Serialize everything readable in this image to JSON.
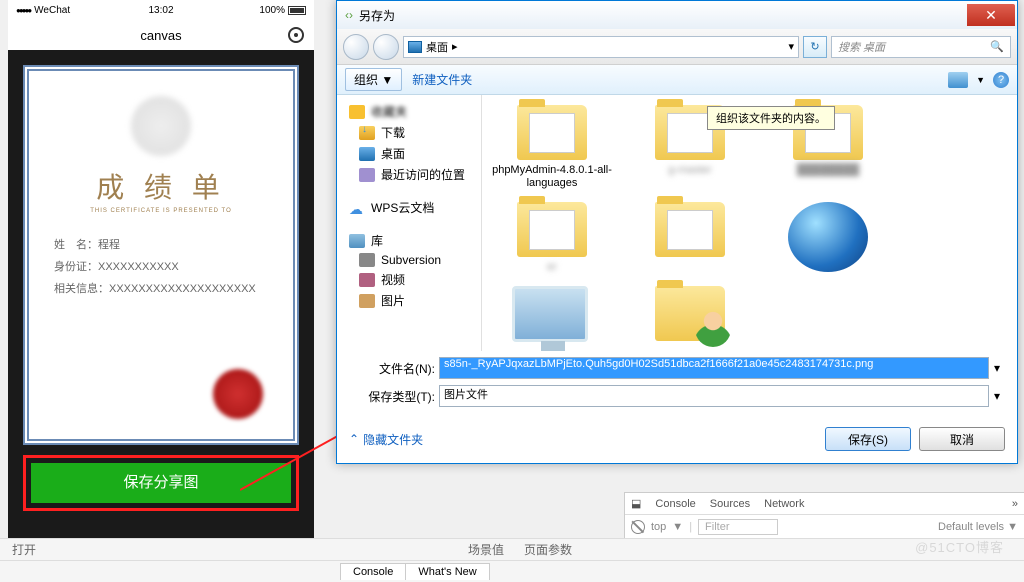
{
  "phone": {
    "carrier": "WeChat",
    "time": "13:02",
    "battery": "100%",
    "title": "canvas",
    "cert": {
      "title": "成 绩 单",
      "sub": "THIS CERTIFICATE IS PRESENTED TO",
      "name_label": "姓　名：",
      "name_value": "程程",
      "id_label": "身份证：",
      "id_value": "XXXXXXXXXXX",
      "info_label": "相关信息：",
      "info_value": "XXXXXXXXXXXXXXXXXXXX"
    },
    "share_button": "保存分享图"
  },
  "dialog": {
    "title": "另存为",
    "breadcrumb": "桌面",
    "breadcrumb_arrow": "▸",
    "search_placeholder": "搜索 桌面",
    "organize": "组织",
    "dropdown": "▼",
    "new_folder": "新建文件夹",
    "tooltip": "组织该文件夹的内容。",
    "tree": {
      "downloads": "下载",
      "desktop": "桌面",
      "recent": "最近访问的位置",
      "wps": "WPS云文档",
      "library": "库",
      "subversion": "Subversion",
      "video": "视频",
      "images": "图片"
    },
    "files": {
      "f1": "phpMyAdmin-4.8.0.1-all-languages",
      "f2": "g-master",
      "f3": "",
      "f4": "er"
    },
    "filename_label": "文件名(N):",
    "filename_value": "s85n-_RyAPJqxazLbMPjEto.Quh5gd0H02Sd51dbca2f1666f21a0e45c2483174731c.png",
    "filetype_label": "保存类型(T):",
    "filetype_value": "图片文件",
    "hide_folders": "隐藏文件夹",
    "save_btn": "保存(S)",
    "cancel_btn": "取消"
  },
  "bottombar": {
    "open": "打开",
    "scene": "场景值",
    "params": "页面参数"
  },
  "devtools": {
    "console": "Console",
    "sources": "Sources",
    "network": "Network",
    "top": "top",
    "filter": "Filter",
    "levels": "Default levels",
    "tab_console": "Console",
    "tab_whatsnew": "What's New"
  },
  "watermark": "@51CTO博客"
}
